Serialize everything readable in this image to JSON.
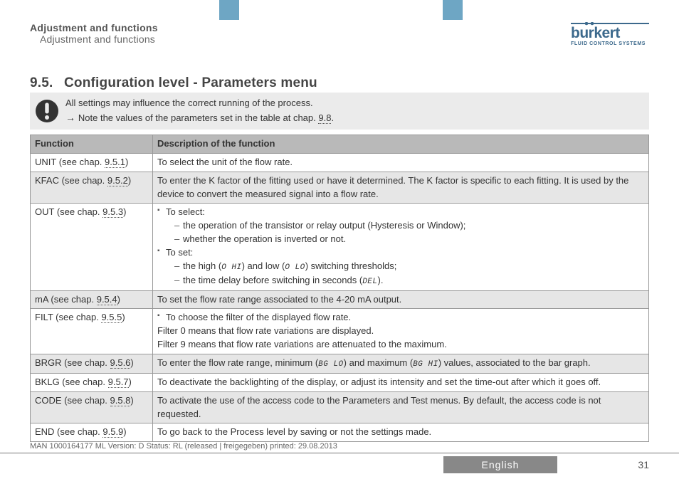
{
  "breadcrumb": {
    "line1": "Adjustment and functions",
    "line2": "Adjustment and functions"
  },
  "logo": {
    "name": "burkert",
    "sub": "FLUID CONTROL SYSTEMS"
  },
  "section": {
    "number": "9.5.",
    "title": "Configuration level - Parameters menu"
  },
  "callout": {
    "line1": "All settings may influence the correct running of the process.",
    "line2_prefix": "Note the values of the parameters set in the table at chap. ",
    "line2_link": "9.8",
    "line2_suffix": "."
  },
  "table": {
    "head": {
      "fn": "Function",
      "desc": "Description of the function"
    },
    "rows": [
      {
        "alt": false,
        "fn_prefix": "UNIT (see chap. ",
        "fn_link": "9.5.1",
        "fn_suffix": ")",
        "desc_plain": "To select the unit of the flow rate."
      },
      {
        "alt": true,
        "fn_prefix": "KFAC (see chap. ",
        "fn_link": "9.5.2",
        "fn_suffix": ")",
        "desc_plain": "To enter the K factor of the fitting used or have it determined. The K factor is specific to each fitting. It is used by the device to convert the measured signal into a flow rate."
      },
      {
        "alt": false,
        "fn_prefix": "OUT (see chap. ",
        "fn_link": "9.5.3",
        "fn_suffix": ")",
        "desc_out": {
          "sel_label": "To select:",
          "sel_items": [
            "the operation of the transistor or relay output (Hysteresis or Window);",
            "whether the operation is inverted or not."
          ],
          "set_label": "To set:",
          "set_items_a_pre": "the high (",
          "set_items_a_seg1": "O HI",
          "set_items_a_mid": ") and low (",
          "set_items_a_seg2": "O LO",
          "set_items_a_post": ") switching thresholds;",
          "set_items_b_pre": "the time delay before switching in seconds (",
          "set_items_b_seg": "DEL",
          "set_items_b_post": ")."
        }
      },
      {
        "alt": true,
        "fn_prefix": "mA (see chap. ",
        "fn_link": "9.5.4",
        "fn_suffix": ")",
        "desc_plain": "To set the flow rate range associated to the 4-20 mA output."
      },
      {
        "alt": false,
        "fn_prefix": "FILT (see chap. ",
        "fn_link": "9.5.5",
        "fn_suffix": ")",
        "desc_filt": {
          "bullet": "To choose the filter of the displayed flow rate.",
          "line1": "Filter 0 means that flow rate variations are displayed.",
          "line2": "Filter 9 means that flow rate variations are attenuated to the maximum."
        }
      },
      {
        "alt": true,
        "fn_prefix": "BRGR (see chap. ",
        "fn_link": "9.5.6",
        "fn_suffix": ")",
        "desc_brgr": {
          "pre": "To enter the flow rate range, minimum (",
          "seg1": "BG LO",
          "mid": ") and maximum (",
          "seg2": "BG HI",
          "post": ") values, associated to the bar graph."
        }
      },
      {
        "alt": false,
        "fn_prefix": "BKLG (see chap. ",
        "fn_link": "9.5.7",
        "fn_suffix": ")",
        "desc_plain": "To deactivate the backlighting of the display, or adjust its intensity and set the time-out after which it goes off."
      },
      {
        "alt": true,
        "fn_prefix": "CODE (see chap. ",
        "fn_link": "9.5.8",
        "fn_suffix": ")",
        "desc_plain": "To activate the use of the access code to the Parameters and Test menus. By default, the access code is not requested."
      },
      {
        "alt": false,
        "fn_prefix": "END (see chap. ",
        "fn_link": "9.5.9",
        "fn_suffix": ")",
        "desc_plain": "To go back to the Process level by saving or not the settings made."
      }
    ]
  },
  "print_line": "MAN  1000164177  ML  Version: D Status: RL  (released | freigegeben)  printed: 29.08.2013",
  "footer": {
    "language": "English",
    "page": "31"
  }
}
